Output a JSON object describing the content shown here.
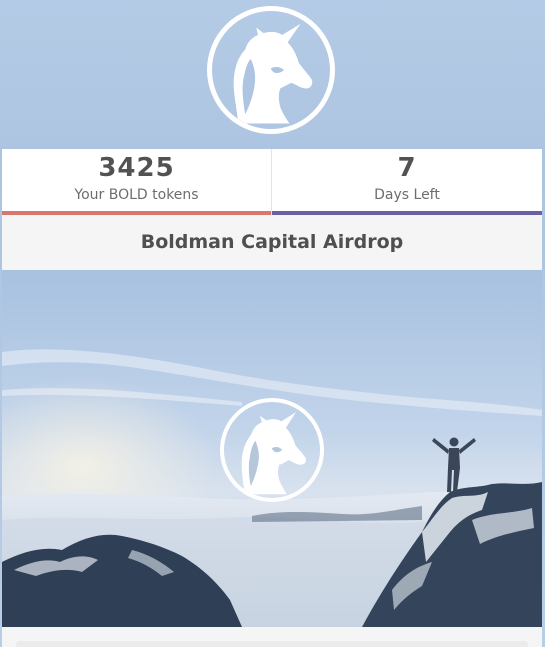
{
  "header": {
    "logo": "unicorn-logo-icon"
  },
  "stats": {
    "tokens": {
      "value": "3425",
      "label": "Your BOLD tokens",
      "accent": "#d9776f"
    },
    "days": {
      "value": "7",
      "label": "Days Left",
      "accent": "#6d5fa3"
    }
  },
  "campaign": {
    "title": "Boldman Capital Airdrop"
  },
  "hero": {
    "image": "mountain-summit-sunrise-image",
    "logo": "unicorn-logo-icon"
  },
  "colors": {
    "sky": "#aec6e1",
    "card": "#ffffff",
    "band": "#f5f5f5"
  }
}
